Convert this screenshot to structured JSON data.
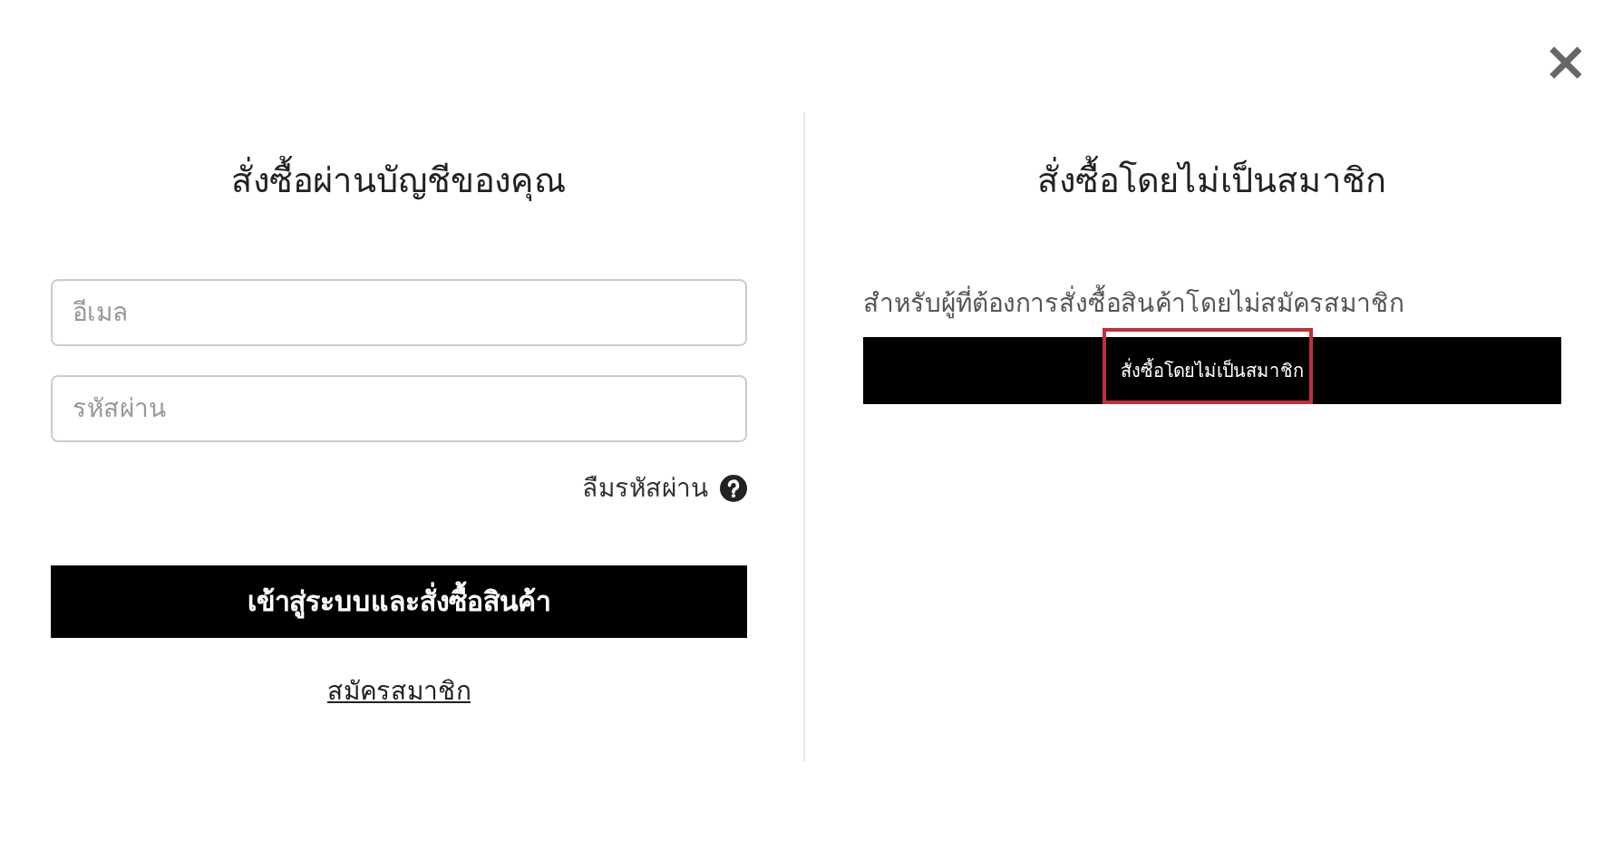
{
  "close_label": "×",
  "member": {
    "title": "สั่งซื้อผ่านบัญชีของคุณ",
    "fields": [
      {
        "placeholder": "อีเมล"
      },
      {
        "placeholder": "รหัสผ่าน"
      }
    ],
    "forgot_link": "ลืมรหัสผ่าน",
    "login_button": "เข้าสู่ระบบและสั่งซื้อสินค้า",
    "register_link": "สมัครสมาชิก"
  },
  "guest": {
    "title": "สั่งซื้อโดยไม่เป็นสมาชิก",
    "description": "สำหรับผู้ที่ต้องการสั่งซื้อสินค้าโดยไม่สมัครสมาชิก",
    "button": {
      "label": "สั่งซื้อโดยไม่เป็นสมาชิก",
      "highlighted": true
    }
  }
}
